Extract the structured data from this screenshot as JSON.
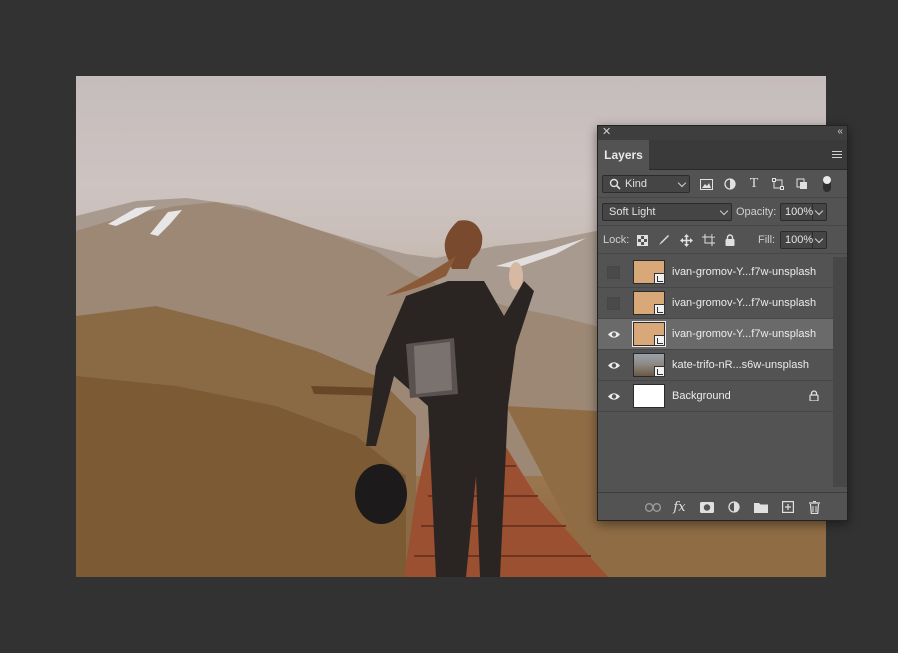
{
  "panel": {
    "tab_label": "Layers",
    "kind_filter": {
      "label": "Kind",
      "icon": "search-icon"
    },
    "filter_icons": [
      "image-filter-icon",
      "adjustment-filter-icon",
      "type-filter-icon",
      "shape-filter-icon",
      "smart-object-filter-icon"
    ],
    "blend_mode": "Soft Light",
    "opacity_label": "Opacity:",
    "opacity_value": "100%",
    "lock_label": "Lock:",
    "lock_icons": [
      "lock-transparent-icon",
      "lock-image-icon",
      "lock-position-icon",
      "lock-artboard-icon",
      "lock-all-icon"
    ],
    "fill_label": "Fill:",
    "fill_value": "100%",
    "layers": [
      {
        "name": "ivan-gromov-Y...f7w-unsplash",
        "visible": false,
        "selected": false,
        "thumb": "peach",
        "smart_object": true
      },
      {
        "name": "ivan-gromov-Y...f7w-unsplash",
        "visible": false,
        "selected": false,
        "thumb": "peach",
        "smart_object": true
      },
      {
        "name": "ivan-gromov-Y...f7w-unsplash",
        "visible": true,
        "selected": true,
        "thumb": "peach",
        "smart_object": true
      },
      {
        "name": "kate-trifo-nR...s6w-unsplash",
        "visible": true,
        "selected": false,
        "thumb": "photo",
        "smart_object": true
      },
      {
        "name": "Background",
        "visible": true,
        "selected": false,
        "thumb": "white",
        "locked": true
      }
    ],
    "footer_icons": [
      "link-layers-icon",
      "fx-icon",
      "add-mask-icon",
      "adjustment-layer-icon",
      "new-group-icon",
      "new-layer-icon",
      "trash-icon"
    ]
  },
  "colors": {
    "app_background": "#323232",
    "panel_background": "#535353",
    "selected_layer": "#6a6a6a",
    "peach_thumbnail": "#d9a878"
  }
}
